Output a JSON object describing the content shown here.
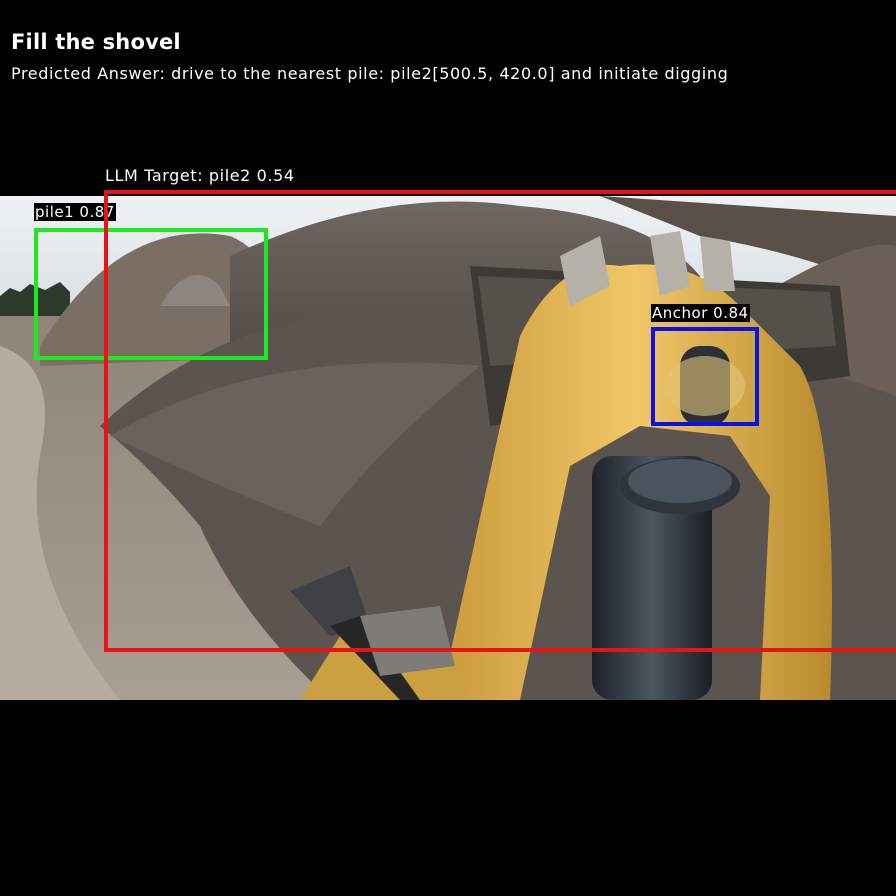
{
  "header": {
    "title": "Fill the shovel",
    "predicted_answer": "Predicted Answer: drive to the nearest pile: pile2[500.5, 420.0] and initiate digging"
  },
  "detections": {
    "pile1": {
      "label": "pile1 0.87",
      "color": "#1fe81f"
    },
    "anchor": {
      "label": "Anchor 0.84",
      "color": "#0a14e0"
    },
    "llm_target": {
      "label": "LLM Target: pile2 0.54",
      "color": "#e61414"
    }
  }
}
